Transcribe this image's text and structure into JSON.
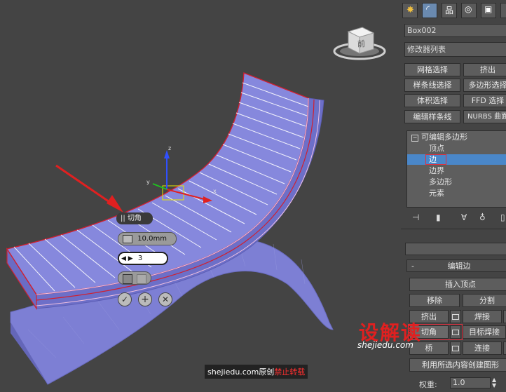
{
  "viewport": {
    "viewcube_label": "前",
    "chamfer_caddy": {
      "title": "切角",
      "amount": "10.0mm",
      "segments": "3"
    }
  },
  "panel": {
    "object_name": "Box002",
    "modifier_list": "修改器列表",
    "modifier_buttons": [
      "网格选择",
      "挤出",
      "样条线选择",
      "多边形选择",
      "体积选择",
      "FFD 选择",
      "编辑样条线",
      "NURBS 曲面"
    ],
    "stack": {
      "root": "可编辑多边形",
      "items": [
        "顶点",
        "边",
        "边界",
        "多边形",
        "元素"
      ],
      "selected_index": 1
    },
    "rollout_title": "编辑边",
    "insert_vertex": "插入顶点",
    "remove": "移除",
    "split": "分割",
    "extrude": "挤出",
    "weld": "焊接",
    "chamfer": "切角",
    "target_weld": "目标焊接",
    "bridge": "桥",
    "connect": "连接",
    "create_shape": "利用所选内容创建图形",
    "weight_label": "权重:",
    "weight_value": "1.0"
  },
  "watermark": {
    "logo_text": "设解读",
    "domain": "shejiedu.com",
    "notice_site": "shejiedu.com原创",
    "notice_warning": "禁止转载"
  },
  "colors": {
    "accent": "#4a87c9",
    "mesh": "#7f80d8",
    "edge_selected": "#d02030",
    "watermark_red": "#e02020"
  }
}
